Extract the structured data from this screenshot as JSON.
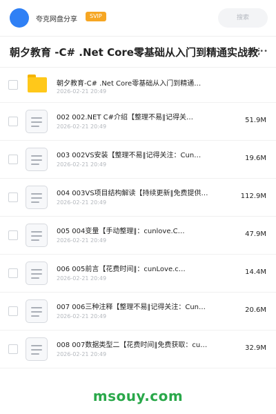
{
  "header": {
    "username": "夸克网盘分享",
    "badge": "SVIP",
    "search_placeholder": "搜索"
  },
  "title": {
    "text": "朝夕教育 -C# .Net Core零基础从入门到精通实战教程",
    "more_icon": "ellipsis-icon",
    "more_glyph": "•••"
  },
  "folder": {
    "name": "朝夕教育-C# .Net Core零基础从入门到精通…",
    "date": "2026-02-21 20:49"
  },
  "files": [
    {
      "name": "002 002.NET C#介绍【整理不易‖记得关…",
      "date": "2026-02-21 20:49",
      "size": "51.9M"
    },
    {
      "name": "003 002VS安装【整理不易‖记得关注：Cun…",
      "date": "2026-02-21 20:49",
      "size": "19.6M"
    },
    {
      "name": "004 003VS项目结构解读【持续更新‖免费提供…",
      "date": "2026-02-21 20:49",
      "size": "112.9M"
    },
    {
      "name": "005 004变量【手动整理‖：cunlove.C…",
      "date": "2026-02-21 20:49",
      "size": "47.9M"
    },
    {
      "name": "006 005前言【花费时间‖：cunLove.c…",
      "date": "2026-02-21 20:49",
      "size": "14.4M"
    },
    {
      "name": "007 006三种注释【整理不易‖记得关注：Cun…",
      "date": "2026-02-21 20:49",
      "size": "20.6M"
    },
    {
      "name": "008 007数据类型二【花费时间‖免费获取：cu…",
      "date": "2026-02-21 20:49",
      "size": "32.9M"
    }
  ],
  "watermark": "msouy.com",
  "colors": {
    "accent": "#2f80f5",
    "badge": "#f6a623",
    "folder": "#ffc81a",
    "watermark": "#2aa84a"
  }
}
